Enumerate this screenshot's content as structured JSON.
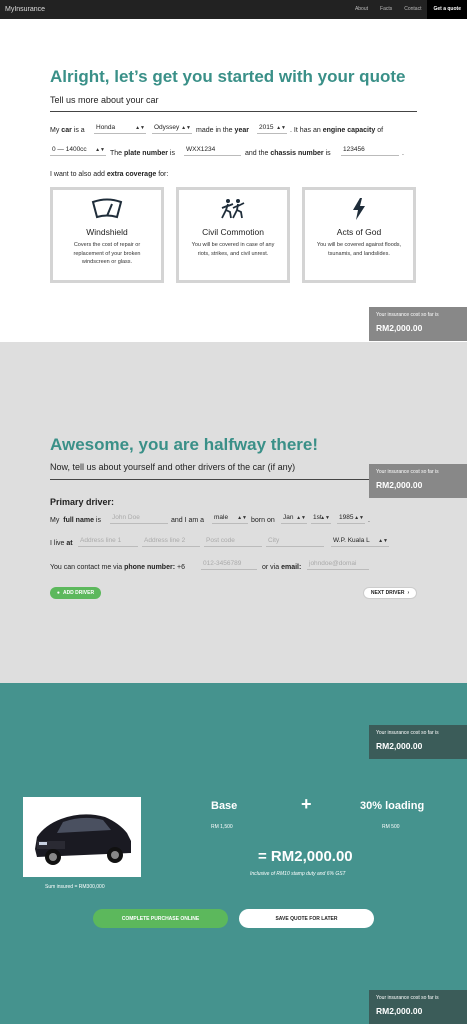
{
  "nav": {
    "brand": "MyInsurance",
    "links": [
      "About",
      "Facts",
      "Contact"
    ],
    "cta": "Get a quote"
  },
  "car_section": {
    "title": "Alright, let’s get you started with your quote",
    "subtitle": "Tell us more about your car",
    "my_car_pre": "My",
    "my_car_bold": "car",
    "my_car_post": "is a",
    "make": "Honda",
    "model": "Odyssey",
    "made_in": "made in the",
    "year_bold": "year",
    "year": "2015",
    "engine_pre": ". It has an",
    "engine_bold": "engine capacity",
    "engine_post": "of",
    "capacity": "0 — 1400cc",
    "the": "The",
    "plate_bold": "plate number",
    "is": "is",
    "plate": "WXX1234",
    "and_the": "and the",
    "chassis_bold": "chassis number",
    "chassis": "123456",
    "dot": ".",
    "coverage_pre": "I want to also add",
    "coverage_bold": "extra coverage",
    "coverage_post": "for:",
    "cards": [
      {
        "title": "Windshield",
        "desc": "Covers the cost of repair or replacement of your broken windscreen or glass."
      },
      {
        "title": "Civil Commotion",
        "desc": "You will be covered in case of any riots, strikes, and civil unrest."
      },
      {
        "title": "Acts of God",
        "desc": "You will be covered against floods, tsunamis, and landslides."
      }
    ]
  },
  "cost_box": {
    "label": "Your insurance cost so far is",
    "value": "RM2,000.00"
  },
  "driver_section": {
    "title": "Awesome, you are halfway there!",
    "subtitle": "Now, tell us about yourself and other drivers of the car (if any)",
    "primary": "Primary driver:",
    "my": "My",
    "fullname_bold": "full name",
    "is": "is",
    "name_placeholder": "John Doe",
    "and_i_am_a": "and I am a",
    "gender": "male",
    "born_on": "born on",
    "month": "Jan",
    "day": "1st",
    "year": "1985",
    "dot": ".",
    "i_live_at_pre": "I live",
    "i_live_at_bold": "at",
    "addr1": "Address line 1",
    "addr2": "Address line 2",
    "postcode": "Post code",
    "city": "City",
    "state": "W.P. Kuala L",
    "contact_pre": "You can contact me via",
    "phone_bold": "phone number:",
    "phone_prefix": "+6",
    "phone_placeholder": "012-3456789",
    "or_via": "or via",
    "email_bold": "email:",
    "email_placeholder": "johndoe@domai",
    "add_driver": "ADD DRIVER",
    "next_driver": "NEXT DRIVER"
  },
  "summary_section": {
    "base_label": "Base",
    "base_value": "RM 1,500",
    "plus": "+",
    "loading_label": "30% loading",
    "loading_value": "RM 500",
    "total": "= RM2,000.00",
    "total_note": "Inclusive of RM10 stamp duty and 6% GST",
    "sum_insured": "Sum insured = RM300,000",
    "complete_btn": "COMPLETE PURCHASE ONLINE",
    "save_btn": "SAVE QUOTE FOR LATER"
  },
  "colors": {
    "teal": "#3a9088",
    "teal_bg": "#45938e",
    "green": "#5cb85c",
    "nav": "#222222"
  }
}
